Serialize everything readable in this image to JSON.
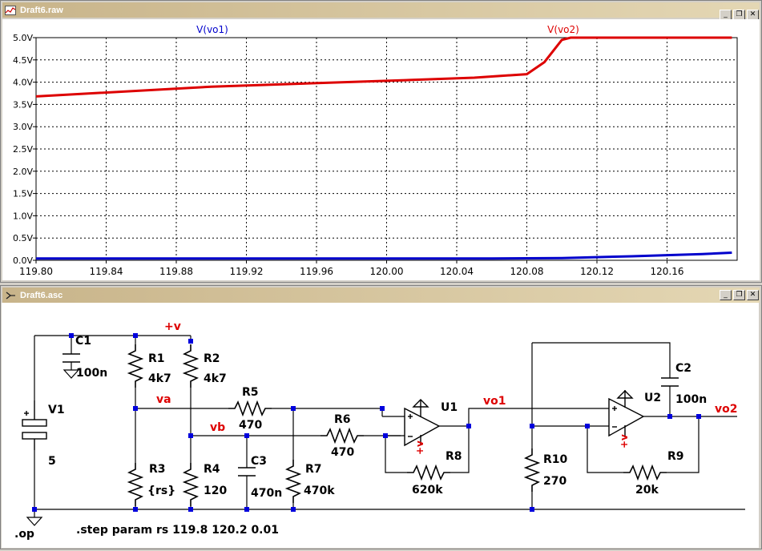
{
  "plot_window": {
    "title": "Draft6.raw",
    "icon": "waveform-icon",
    "controls": [
      "minimize",
      "restore",
      "close"
    ]
  },
  "schematic_window": {
    "title": "Draft6.asc",
    "icon": "schematic-icon",
    "controls": [
      "minimize",
      "restore",
      "close"
    ]
  },
  "chart_data": {
    "type": "line",
    "xlim": [
      119.8,
      120.2
    ],
    "ylim": [
      0,
      5
    ],
    "x_ticks": [
      "119.80",
      "119.84",
      "119.88",
      "119.92",
      "119.96",
      "120.00",
      "120.04",
      "120.08",
      "120.12",
      "120.16"
    ],
    "x_tick_values": [
      119.8,
      119.84,
      119.88,
      119.92,
      119.96,
      120.0,
      120.04,
      120.08,
      120.12,
      120.16
    ],
    "y_ticks": [
      "0.0V",
      "0.5V",
      "1.0V",
      "1.5V",
      "2.0V",
      "2.5V",
      "3.0V",
      "3.5V",
      "4.0V",
      "4.5V",
      "5.0V"
    ],
    "y_tick_values": [
      0,
      0.5,
      1,
      1.5,
      2,
      2.5,
      3,
      3.5,
      4,
      4.5,
      5
    ],
    "grid": true,
    "series": [
      {
        "name": "V(vo1)",
        "color": "#0000cc",
        "x": [
          119.8,
          119.9,
          120.0,
          120.06,
          120.1,
          120.14,
          120.18,
          120.197
        ],
        "y": [
          0.04,
          0.04,
          0.04,
          0.04,
          0.05,
          0.09,
          0.14,
          0.17
        ]
      },
      {
        "name": "V(vo2)",
        "color": "#dd0000",
        "x": [
          119.8,
          119.9,
          120.0,
          120.05,
          120.08,
          120.09,
          120.1,
          120.105,
          120.14,
          120.197
        ],
        "y": [
          3.68,
          3.9,
          4.03,
          4.1,
          4.18,
          4.45,
          4.95,
          5.0,
          5.0,
          5.0
        ]
      }
    ]
  },
  "schematic": {
    "directive": ".step param rs 119.8 120.2 0.01",
    "op_label": ".op",
    "components": [
      {
        "ref": "C1",
        "value": "100n"
      },
      {
        "ref": "R1",
        "value": "4k7"
      },
      {
        "ref": "R2",
        "value": "4k7"
      },
      {
        "ref": "V1",
        "value": "5"
      },
      {
        "ref": "R3",
        "value": "{rs}"
      },
      {
        "ref": "R4",
        "value": "120"
      },
      {
        "ref": "C3",
        "value": "470n"
      },
      {
        "ref": "R5",
        "value": "470"
      },
      {
        "ref": "R6",
        "value": "470"
      },
      {
        "ref": "R7",
        "value": "470k"
      },
      {
        "ref": "U1",
        "value": ""
      },
      {
        "ref": "R8",
        "value": "620k"
      },
      {
        "ref": "R10",
        "value": "270"
      },
      {
        "ref": "U2",
        "value": ""
      },
      {
        "ref": "C2",
        "value": "100n"
      },
      {
        "ref": "R9",
        "value": "20k"
      }
    ],
    "nets": {
      "pv": "+v",
      "va": "va",
      "vb": "vb",
      "vo1": "vo1",
      "vo2": "vo2",
      "u1_supply": "+v",
      "u2_supply": "+v"
    },
    "colors": {
      "wire": "#000000",
      "component": "#000000",
      "junction": "#0000dd",
      "net_label": "#dd0000"
    }
  }
}
